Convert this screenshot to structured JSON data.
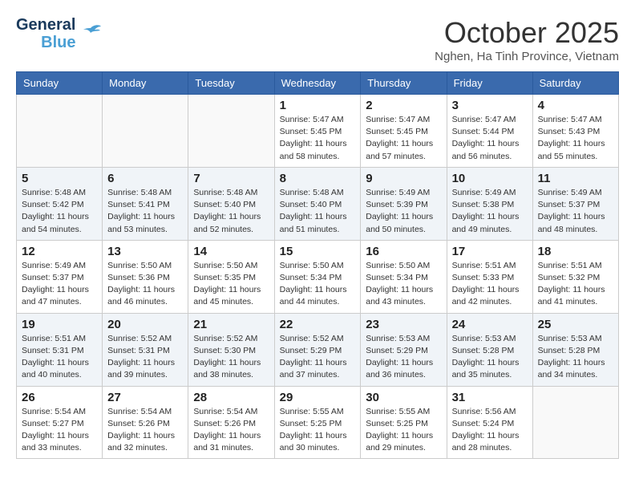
{
  "header": {
    "logo_line1": "General",
    "logo_line2": "Blue",
    "month_title": "October 2025",
    "location": "Nghen, Ha Tinh Province, Vietnam"
  },
  "weekdays": [
    "Sunday",
    "Monday",
    "Tuesday",
    "Wednesday",
    "Thursday",
    "Friday",
    "Saturday"
  ],
  "weeks": [
    [
      {
        "day": "",
        "info": ""
      },
      {
        "day": "",
        "info": ""
      },
      {
        "day": "",
        "info": ""
      },
      {
        "day": "1",
        "info": "Sunrise: 5:47 AM\nSunset: 5:45 PM\nDaylight: 11 hours\nand 58 minutes."
      },
      {
        "day": "2",
        "info": "Sunrise: 5:47 AM\nSunset: 5:45 PM\nDaylight: 11 hours\nand 57 minutes."
      },
      {
        "day": "3",
        "info": "Sunrise: 5:47 AM\nSunset: 5:44 PM\nDaylight: 11 hours\nand 56 minutes."
      },
      {
        "day": "4",
        "info": "Sunrise: 5:47 AM\nSunset: 5:43 PM\nDaylight: 11 hours\nand 55 minutes."
      }
    ],
    [
      {
        "day": "5",
        "info": "Sunrise: 5:48 AM\nSunset: 5:42 PM\nDaylight: 11 hours\nand 54 minutes."
      },
      {
        "day": "6",
        "info": "Sunrise: 5:48 AM\nSunset: 5:41 PM\nDaylight: 11 hours\nand 53 minutes."
      },
      {
        "day": "7",
        "info": "Sunrise: 5:48 AM\nSunset: 5:40 PM\nDaylight: 11 hours\nand 52 minutes."
      },
      {
        "day": "8",
        "info": "Sunrise: 5:48 AM\nSunset: 5:40 PM\nDaylight: 11 hours\nand 51 minutes."
      },
      {
        "day": "9",
        "info": "Sunrise: 5:49 AM\nSunset: 5:39 PM\nDaylight: 11 hours\nand 50 minutes."
      },
      {
        "day": "10",
        "info": "Sunrise: 5:49 AM\nSunset: 5:38 PM\nDaylight: 11 hours\nand 49 minutes."
      },
      {
        "day": "11",
        "info": "Sunrise: 5:49 AM\nSunset: 5:37 PM\nDaylight: 11 hours\nand 48 minutes."
      }
    ],
    [
      {
        "day": "12",
        "info": "Sunrise: 5:49 AM\nSunset: 5:37 PM\nDaylight: 11 hours\nand 47 minutes."
      },
      {
        "day": "13",
        "info": "Sunrise: 5:50 AM\nSunset: 5:36 PM\nDaylight: 11 hours\nand 46 minutes."
      },
      {
        "day": "14",
        "info": "Sunrise: 5:50 AM\nSunset: 5:35 PM\nDaylight: 11 hours\nand 45 minutes."
      },
      {
        "day": "15",
        "info": "Sunrise: 5:50 AM\nSunset: 5:34 PM\nDaylight: 11 hours\nand 44 minutes."
      },
      {
        "day": "16",
        "info": "Sunrise: 5:50 AM\nSunset: 5:34 PM\nDaylight: 11 hours\nand 43 minutes."
      },
      {
        "day": "17",
        "info": "Sunrise: 5:51 AM\nSunset: 5:33 PM\nDaylight: 11 hours\nand 42 minutes."
      },
      {
        "day": "18",
        "info": "Sunrise: 5:51 AM\nSunset: 5:32 PM\nDaylight: 11 hours\nand 41 minutes."
      }
    ],
    [
      {
        "day": "19",
        "info": "Sunrise: 5:51 AM\nSunset: 5:31 PM\nDaylight: 11 hours\nand 40 minutes."
      },
      {
        "day": "20",
        "info": "Sunrise: 5:52 AM\nSunset: 5:31 PM\nDaylight: 11 hours\nand 39 minutes."
      },
      {
        "day": "21",
        "info": "Sunrise: 5:52 AM\nSunset: 5:30 PM\nDaylight: 11 hours\nand 38 minutes."
      },
      {
        "day": "22",
        "info": "Sunrise: 5:52 AM\nSunset: 5:29 PM\nDaylight: 11 hours\nand 37 minutes."
      },
      {
        "day": "23",
        "info": "Sunrise: 5:53 AM\nSunset: 5:29 PM\nDaylight: 11 hours\nand 36 minutes."
      },
      {
        "day": "24",
        "info": "Sunrise: 5:53 AM\nSunset: 5:28 PM\nDaylight: 11 hours\nand 35 minutes."
      },
      {
        "day": "25",
        "info": "Sunrise: 5:53 AM\nSunset: 5:28 PM\nDaylight: 11 hours\nand 34 minutes."
      }
    ],
    [
      {
        "day": "26",
        "info": "Sunrise: 5:54 AM\nSunset: 5:27 PM\nDaylight: 11 hours\nand 33 minutes."
      },
      {
        "day": "27",
        "info": "Sunrise: 5:54 AM\nSunset: 5:26 PM\nDaylight: 11 hours\nand 32 minutes."
      },
      {
        "day": "28",
        "info": "Sunrise: 5:54 AM\nSunset: 5:26 PM\nDaylight: 11 hours\nand 31 minutes."
      },
      {
        "day": "29",
        "info": "Sunrise: 5:55 AM\nSunset: 5:25 PM\nDaylight: 11 hours\nand 30 minutes."
      },
      {
        "day": "30",
        "info": "Sunrise: 5:55 AM\nSunset: 5:25 PM\nDaylight: 11 hours\nand 29 minutes."
      },
      {
        "day": "31",
        "info": "Sunrise: 5:56 AM\nSunset: 5:24 PM\nDaylight: 11 hours\nand 28 minutes."
      },
      {
        "day": "",
        "info": ""
      }
    ]
  ]
}
